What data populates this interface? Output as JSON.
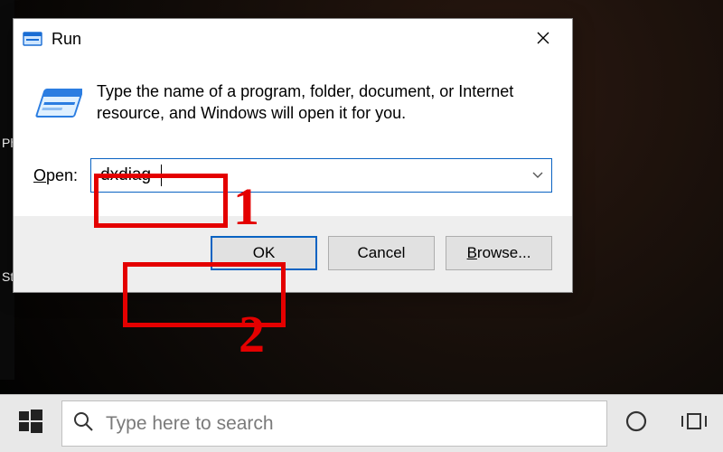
{
  "run": {
    "title": "Run",
    "description": "Type the name of a program, folder, document, or Internet resource, and Windows will open it for you.",
    "open_label_pre": "O",
    "open_label_rest": "pen:",
    "input_value": "dxdiag",
    "buttons": {
      "ok": "OK",
      "cancel": "Cancel",
      "browse_u": "B",
      "browse_rest": "rowse..."
    }
  },
  "annotations": {
    "one": "1",
    "two": "2"
  },
  "taskbar": {
    "search_placeholder": "Type here to search"
  },
  "sidetext": {
    "ph": "Ph",
    "st": "St"
  }
}
